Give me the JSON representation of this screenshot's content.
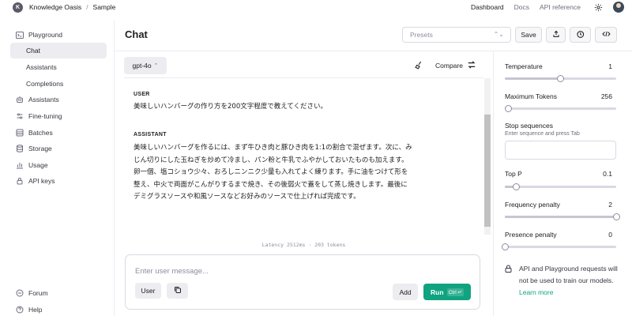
{
  "topbar": {
    "org_initial": "K",
    "org_name": "Knowledge Oasis",
    "separator": "/",
    "project": "Sample",
    "nav": [
      "Dashboard",
      "Docs",
      "API reference"
    ]
  },
  "sidebar": {
    "items": [
      {
        "label": "Playground",
        "icon": "terminal-icon"
      },
      {
        "label": "Chat",
        "sub": true,
        "active": true
      },
      {
        "label": "Assistants",
        "sub": true
      },
      {
        "label": "Completions",
        "sub": true
      },
      {
        "label": "Assistants",
        "icon": "robot-icon"
      },
      {
        "label": "Fine-tuning",
        "icon": "tune-icon"
      },
      {
        "label": "Batches",
        "icon": "batches-icon"
      },
      {
        "label": "Storage",
        "icon": "database-icon"
      },
      {
        "label": "Usage",
        "icon": "chart-icon"
      },
      {
        "label": "API keys",
        "icon": "lock-icon"
      }
    ],
    "footer": [
      {
        "label": "Forum",
        "icon": "forum-icon"
      },
      {
        "label": "Help",
        "icon": "help-icon"
      }
    ]
  },
  "header": {
    "title": "Chat",
    "presets_placeholder": "Presets",
    "save_label": "Save"
  },
  "chat": {
    "model": "gpt-4o",
    "compare_label": "Compare",
    "messages": [
      {
        "role": "USER",
        "text": "美味しいハンバーグの作り方を200文字程度で教えてください。"
      },
      {
        "role": "ASSISTANT",
        "lines": [
          "美味しいハンバーグを作るには、まず牛ひき肉と豚ひき肉を1:1の割合で混ぜます。次に、み",
          "じん切りにした玉ねぎを炒めて冷まし、パン粉と牛乳でふやかしておいたものも加えます。",
          "卵一個、塩コショウ少々、おろしニンニク少量も入れてよく練ります。手に油をつけて形を",
          "整え、中火で両面がこんがりするまで焼き、その後弱火で蓋をして蒸し焼きします。最後に",
          "デミグラスソースや和風ソースなどお好みのソースで仕上げれば完成です。"
        ]
      }
    ],
    "latency": "Latency 2512ms · 203 tokens",
    "input_placeholder": "Enter user message...",
    "role_button": "User",
    "add_button": "Add",
    "run_button": "Run",
    "run_shortcut": "Ctrl ↵"
  },
  "settings": {
    "temperature": {
      "label": "Temperature",
      "value": "1",
      "fraction": 0.5
    },
    "max_tokens": {
      "label": "Maximum Tokens",
      "value": "256",
      "fraction": 0.03
    },
    "stop_sequences": {
      "label": "Stop sequences",
      "hint": "Enter sequence and press Tab"
    },
    "top_p": {
      "label": "Top P",
      "value": "0.1",
      "fraction": 0.1
    },
    "frequency_penalty": {
      "label": "Frequency penalty",
      "value": "2",
      "fraction": 1.0
    },
    "presence_penalty": {
      "label": "Presence penalty",
      "value": "0",
      "fraction": 0.0
    },
    "privacy_text": "API and Playground requests will not be used to train our models.",
    "privacy_link": "Learn more"
  },
  "colors": {
    "accent": "#10a37f",
    "active_bg": "#ececf1",
    "border": "#d9d9e3"
  }
}
